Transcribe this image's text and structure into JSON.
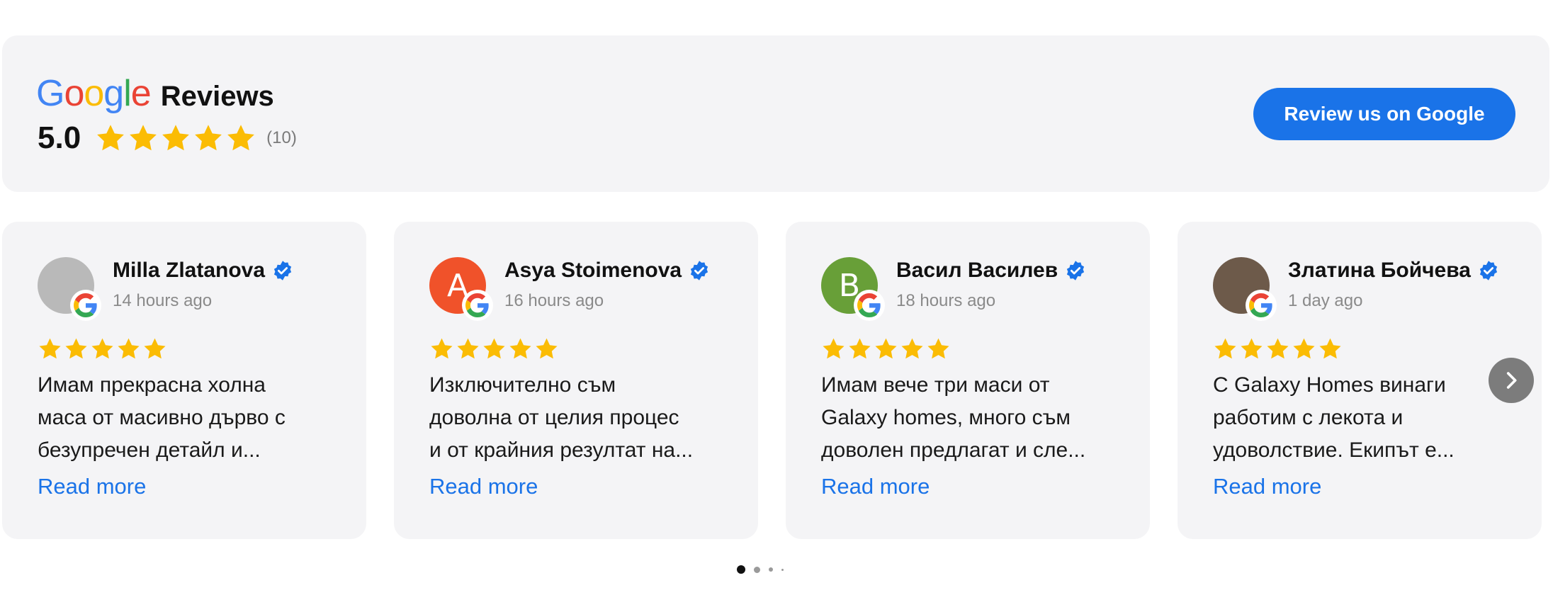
{
  "header": {
    "brand": {
      "g1": "G",
      "o1": "o",
      "o2": "o",
      "g2": "g",
      "l": "l",
      "e": "e"
    },
    "reviews_label": "Reviews",
    "rating_value": "5.0",
    "rating_stars": 5,
    "review_count": "(10)",
    "cta_label": "Review us on Google"
  },
  "colors": {
    "accent": "#1a73e8",
    "star": "#FBBC04",
    "panel": "#f4f4f6"
  },
  "reviews": [
    {
      "name": "Milla Zlatanova",
      "time": "14 hours ago",
      "stars": 5,
      "avatar_initial": "",
      "avatar_color": "#b9b9b9",
      "lines": [
        "Имам прекрасна холна",
        "маса от масивно дърво с",
        "безупречен детайл и..."
      ],
      "read_more": "Read more"
    },
    {
      "name": "Asya Stoimenova",
      "time": "16 hours ago",
      "stars": 5,
      "avatar_initial": "A",
      "avatar_color": "#f0522a",
      "lines": [
        "Изключително съм",
        "доволна от целия процес",
        "и от крайния резултат на..."
      ],
      "read_more": "Read more"
    },
    {
      "name": "Васил Василев",
      "time": "18 hours ago",
      "stars": 5,
      "avatar_initial": "B",
      "avatar_color": "#689f38",
      "lines": [
        "Имам вече три маси от",
        "Galaxy homes, много съм",
        "доволен предлагат и сле..."
      ],
      "read_more": "Read more"
    },
    {
      "name": "Златина Бойчева",
      "time": "1 day ago",
      "stars": 5,
      "avatar_initial": "",
      "avatar_color": "#6d5a4a",
      "lines": [
        "С Galaxy Homes винаги",
        "работим с лекота и",
        "удоволствие. Екипът е..."
      ],
      "read_more": "Read more"
    }
  ],
  "pagination": {
    "pages": 4,
    "active": 1
  }
}
